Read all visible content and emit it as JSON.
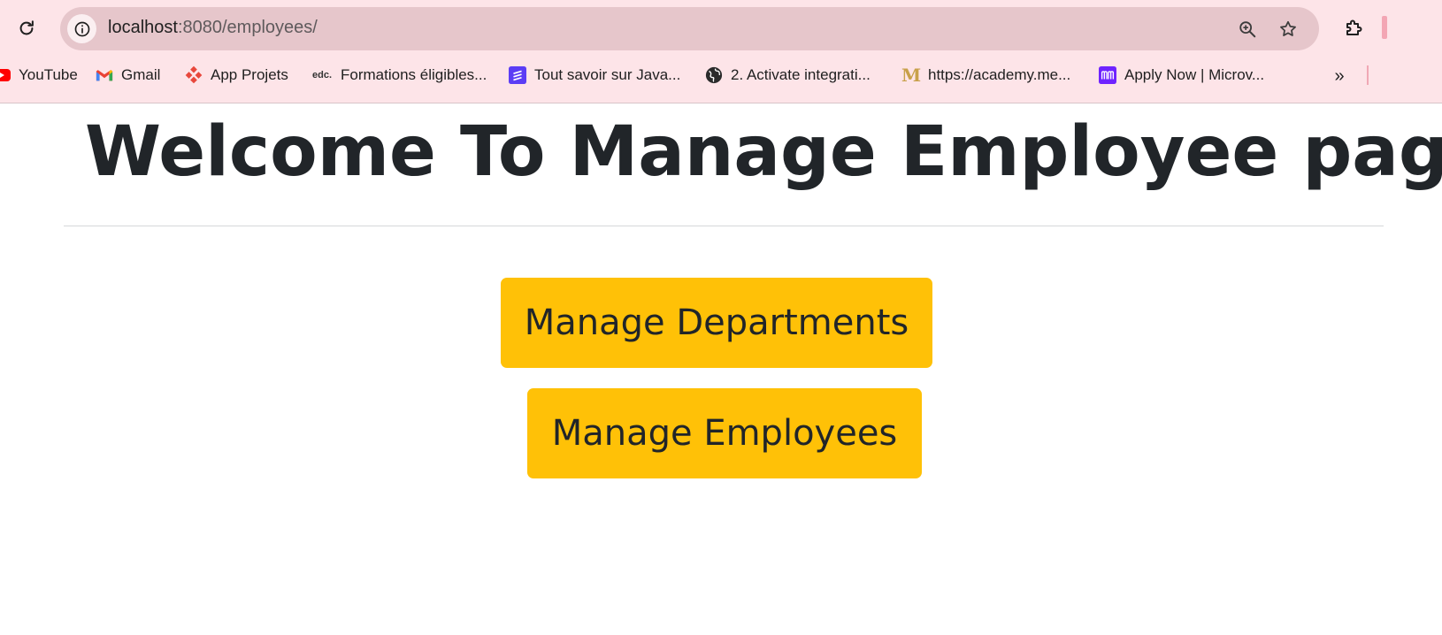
{
  "browser": {
    "url_host": "localhost",
    "url_rest": ":8080/employees/",
    "bookmarks": [
      {
        "label": "YouTube",
        "icon": "youtube-icon"
      },
      {
        "label": "Gmail",
        "icon": "gmail-icon"
      },
      {
        "label": "App Projets",
        "icon": "app-projets-icon"
      },
      {
        "label": "Formations éligibles...",
        "icon": "edc-icon",
        "icon_text": "edc."
      },
      {
        "label": "Tout savoir sur Java...",
        "icon": "java-bookmark-icon"
      },
      {
        "label": "2. Activate integrati...",
        "icon": "globe-icon"
      },
      {
        "label": "https://academy.me...",
        "icon": "academy-icon",
        "icon_text": "M"
      },
      {
        "label": "Apply Now | Microv...",
        "icon": "microverse-icon"
      }
    ],
    "more_bookmarks": "»"
  },
  "page": {
    "title": "Welcome To Manage Employee page",
    "buttons": {
      "departments": "Manage Departments",
      "employees": "Manage Employees"
    }
  },
  "colors": {
    "chrome_bg": "#fde4e8",
    "omnibox_bg": "#e6c6cb",
    "button_bg": "#ffc107",
    "text": "#212529"
  }
}
